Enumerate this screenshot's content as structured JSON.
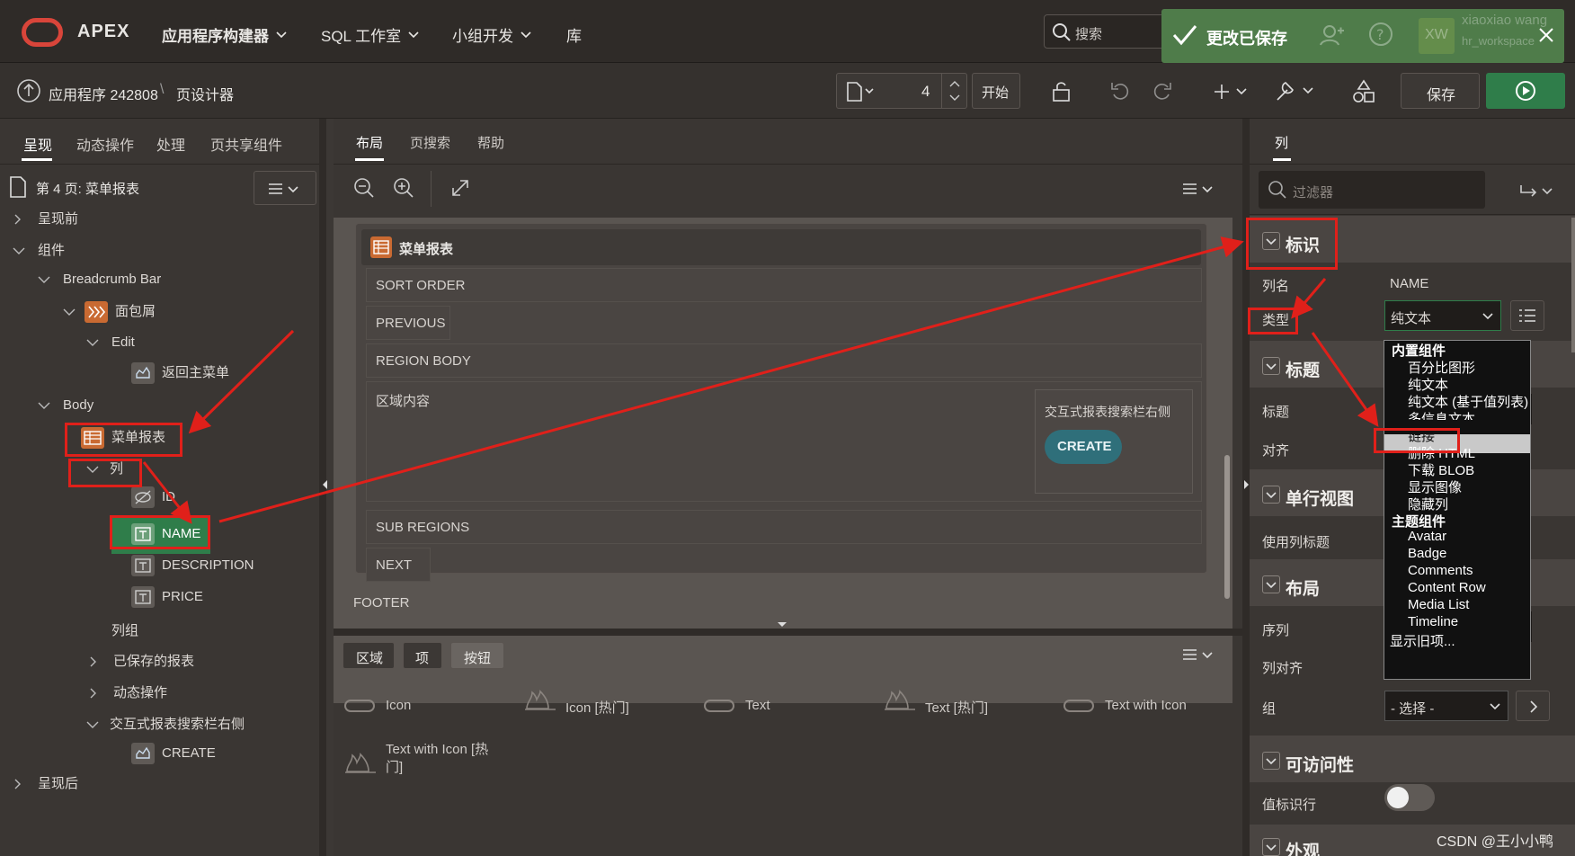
{
  "topbar": {
    "brand": "APEX",
    "nav": [
      "应用程序构建器",
      "SQL 工作室",
      "小组开发",
      "库"
    ],
    "search_placeholder": "搜索",
    "toast": "更改已保存",
    "user_name": "xiaoxiao wang",
    "user_initials": "XW",
    "user_sub": "hr_workspace"
  },
  "subbar": {
    "breadcrumb_app": "应用程序 242808",
    "breadcrumb_sep": "\\",
    "breadcrumb_page": "页设计器",
    "page_number": "4",
    "go_label": "开始",
    "save_label": "保存"
  },
  "left": {
    "tabs": [
      "呈现",
      "动态操作",
      "处理",
      "页共享组件"
    ],
    "page_title": "第 4 页: 菜单报表",
    "tree": [
      "呈现前",
      "组件",
      "Breadcrumb Bar",
      "面包屑",
      "Edit",
      "返回主菜单",
      "Body",
      "菜单报表",
      "列",
      "ID",
      "NAME",
      "DESCRIPTION",
      "PRICE",
      "列组",
      "已保存的报表",
      "动态操作",
      "交互式报表搜索栏右侧",
      "CREATE",
      "呈现后"
    ]
  },
  "center": {
    "tabs": [
      "布局",
      "页搜索",
      "帮助"
    ],
    "region_title": "菜单报表",
    "slots": [
      "SORT ORDER",
      "PREVIOUS",
      "REGION BODY",
      "区域内容",
      "SUB REGIONS",
      "NEXT"
    ],
    "ir_search_label": "交互式报表搜索栏右侧",
    "create_label": "CREATE",
    "footer": "FOOTER",
    "gallery_tabs": [
      "区域",
      "项",
      "按钮"
    ],
    "gallery_items": [
      "Icon",
      "Icon [热门]",
      "Text",
      "Text [热门]",
      "Text with Icon",
      "Text with Icon [热门]"
    ]
  },
  "right": {
    "tab": "列",
    "filter_placeholder": "过滤器",
    "sections": [
      "标识",
      "标题",
      "单行视图",
      "布局",
      "可访问性",
      "外观"
    ],
    "props": {
      "column_name_label": "列名",
      "column_name_value": "NAME",
      "type_label": "类型",
      "type_value": "纯文本",
      "heading_label": "标题",
      "align_label": "对齐",
      "use_heading_label": "使用列标题",
      "sequence_label": "序列",
      "col_align_label": "列对齐",
      "group_label": "组",
      "group_value": "- 选择 -",
      "value_identifies_row": "值标识行"
    },
    "dropdown": {
      "group1": "内置组件",
      "builtin": [
        "百分比图形",
        "纯文本",
        "纯文本 (基于值列表)",
        "多信息文本",
        "链接",
        "删除 HTML",
        "下载 BLOB",
        "显示图像",
        "隐藏列"
      ],
      "group2": "主题组件",
      "theme": [
        "Avatar",
        "Badge",
        "Comments",
        "Content Row",
        "Media List",
        "Timeline"
      ],
      "legacy": "显示旧项..."
    }
  },
  "watermark": "CSDN @王小小鸭",
  "colors": {
    "accent_green": "#2f7d4a",
    "toast_green": "#4f7c4a",
    "annotation_red": "#e0201a",
    "logo_red": "#d9453a"
  }
}
